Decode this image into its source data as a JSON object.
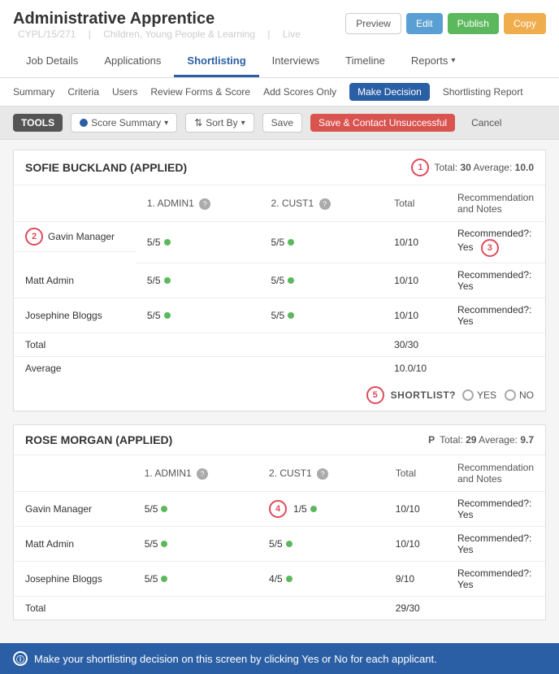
{
  "header": {
    "title": "Administrative Apprentice",
    "subtitle_id": "CYPL/15/271",
    "subtitle_dept": "Children, Young People & Learning",
    "subtitle_status": "Live",
    "btn_preview": "Preview",
    "btn_edit": "Edit",
    "btn_publish": "Publish",
    "btn_copy": "Copy"
  },
  "nav": {
    "tabs": [
      {
        "label": "Job Details",
        "active": false
      },
      {
        "label": "Applications",
        "active": false
      },
      {
        "label": "Shortlisting",
        "active": true
      },
      {
        "label": "Interviews",
        "active": false
      },
      {
        "label": "Timeline",
        "active": false
      },
      {
        "label": "Reports",
        "active": false
      }
    ]
  },
  "sub_nav": {
    "items": [
      {
        "label": "Summary",
        "active": false
      },
      {
        "label": "Criteria",
        "active": false
      },
      {
        "label": "Users",
        "active": false
      },
      {
        "label": "Review Forms & Score",
        "active": false
      },
      {
        "label": "Add Scores Only",
        "active": false
      },
      {
        "label": "Make Decision",
        "active": true
      },
      {
        "label": "Shortlisting Report",
        "active": false
      }
    ]
  },
  "tools": {
    "label": "TOOLS",
    "score_summary": "Score Summary",
    "sort_by": "Sort By",
    "save": "Save",
    "save_contact": "Save & Contact Unsuccessful",
    "cancel": "Cancel"
  },
  "applicants": [
    {
      "id": "175",
      "name": "SOFIE BUCKLAND (APPLIED)",
      "total": "30",
      "average": "10.0",
      "badge_num": "1",
      "columns": {
        "admin": "1. ADMIN1",
        "cust": "2. CUST1",
        "total": "Total",
        "rec": "Recommendation and Notes"
      },
      "rows": [
        {
          "criteria": "Gavin Manager",
          "admin": "5/5",
          "cust": "5/5",
          "total": "10/10",
          "rec": "Recommended?: Yes",
          "badge": "2"
        },
        {
          "criteria": "Matt Admin",
          "admin": "5/5",
          "cust": "5/5",
          "total": "10/10",
          "rec": "Recommended?: Yes",
          "badge": null
        },
        {
          "criteria": "Josephine Bloggs",
          "admin": "5/5",
          "cust": "5/5",
          "total": "10/10",
          "rec": "Recommended?: Yes",
          "badge": null
        },
        {
          "criteria": "Total",
          "admin": "",
          "cust": "",
          "total": "30/30",
          "rec": "",
          "badge": null
        },
        {
          "criteria": "Average",
          "admin": "",
          "cust": "",
          "total": "10.0/10",
          "rec": "",
          "badge": null
        }
      ],
      "shortlist_label": "SHORTLIST?",
      "shortlist_yes": "YES",
      "shortlist_no": "NO",
      "shortlist_badge": "5"
    },
    {
      "id": "172",
      "name": "ROSE MORGAN (APPLIED)",
      "total": "29",
      "average": "9.7",
      "badge_num": null,
      "pending": "P",
      "columns": {
        "admin": "1. ADMIN1",
        "cust": "2. CUST1",
        "total": "Total",
        "rec": "Recommendation and Notes"
      },
      "rows": [
        {
          "criteria": "Gavin Manager",
          "admin": "5/5",
          "cust": "1/5",
          "total": "10/10",
          "rec": "Recommended?: Yes",
          "badge": "4"
        },
        {
          "criteria": "Matt Admin",
          "admin": "5/5",
          "cust": "5/5",
          "total": "10/10",
          "rec": "Recommended?: Yes",
          "badge": null
        },
        {
          "criteria": "Josephine Bloggs",
          "admin": "5/5",
          "cust": "4/5",
          "total": "9/10",
          "rec": "Recommended?: Yes",
          "badge": null
        },
        {
          "criteria": "Total",
          "admin": "",
          "cust": "",
          "total": "29/30",
          "rec": "",
          "badge": null
        }
      ]
    }
  ],
  "bottom_bar": {
    "message": "Make your shortlisting decision on this screen by clicking Yes or No for each applicant."
  },
  "rec_badge": "3"
}
